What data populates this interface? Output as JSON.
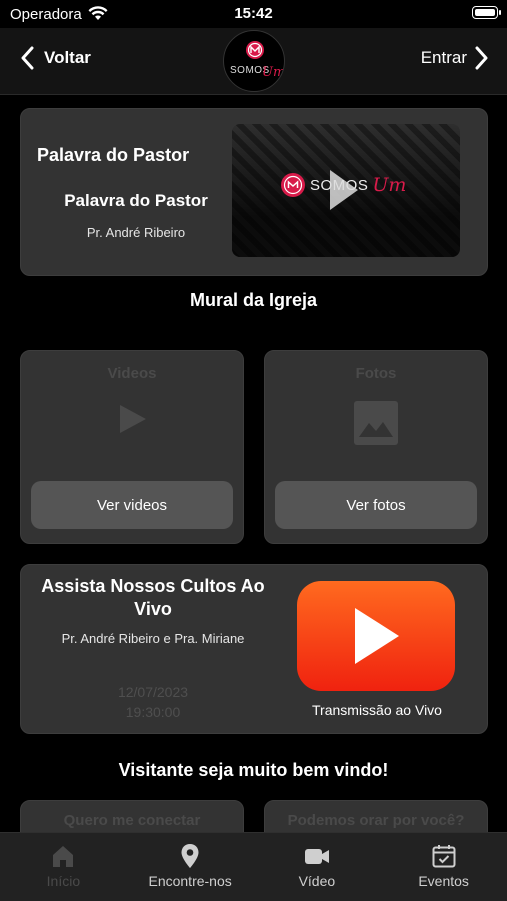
{
  "status_bar": {
    "carrier": "Operadora",
    "time": "15:42"
  },
  "nav": {
    "back_label": "Voltar",
    "login_label": "Entrar",
    "logo_text": "SOMOS",
    "logo_accent_text": "Um"
  },
  "pastor_card": {
    "title": "Palavra do Pastor",
    "subtitle": "Palavra do Pastor",
    "pastor_name": "Pr. André Ribeiro",
    "thumbnail_logo_text": "SOMOS",
    "thumbnail_logo_accent": "Um"
  },
  "mural": {
    "title": "Mural da Igreja"
  },
  "videos_card": {
    "label": "Videos",
    "button_label": "Ver videos"
  },
  "fotos_card": {
    "label": "Fotos",
    "button_label": "Ver fotos"
  },
  "live_card": {
    "title": "Assista Nossos Cultos Ao Vivo",
    "pastors": "Pr. André Ribeiro e Pra. Miriane",
    "date": "12/07/2023",
    "time": "19:30:00",
    "stream_label": "Transmissão ao Vivo"
  },
  "welcome": {
    "title": "Visitante seja muito bem vindo!"
  },
  "small_cards": {
    "connect_label": "Quero me conectar",
    "pray_label": "Podemos orar por você?"
  },
  "tabs": [
    {
      "label": "Início",
      "icon": "home-icon",
      "active": true
    },
    {
      "label": "Encontre-nos",
      "icon": "location-pin-icon",
      "active": false
    },
    {
      "label": "Vídeo",
      "icon": "video-camera-icon",
      "active": false
    },
    {
      "label": "Eventos",
      "icon": "calendar-icon",
      "active": false
    }
  ],
  "colors": {
    "background": "#000000",
    "card": "#333333",
    "button": "#555555",
    "brand_accent": "#d81b4a",
    "youtube_red": "#f0220f",
    "muted_text": "#4a4a4a"
  }
}
